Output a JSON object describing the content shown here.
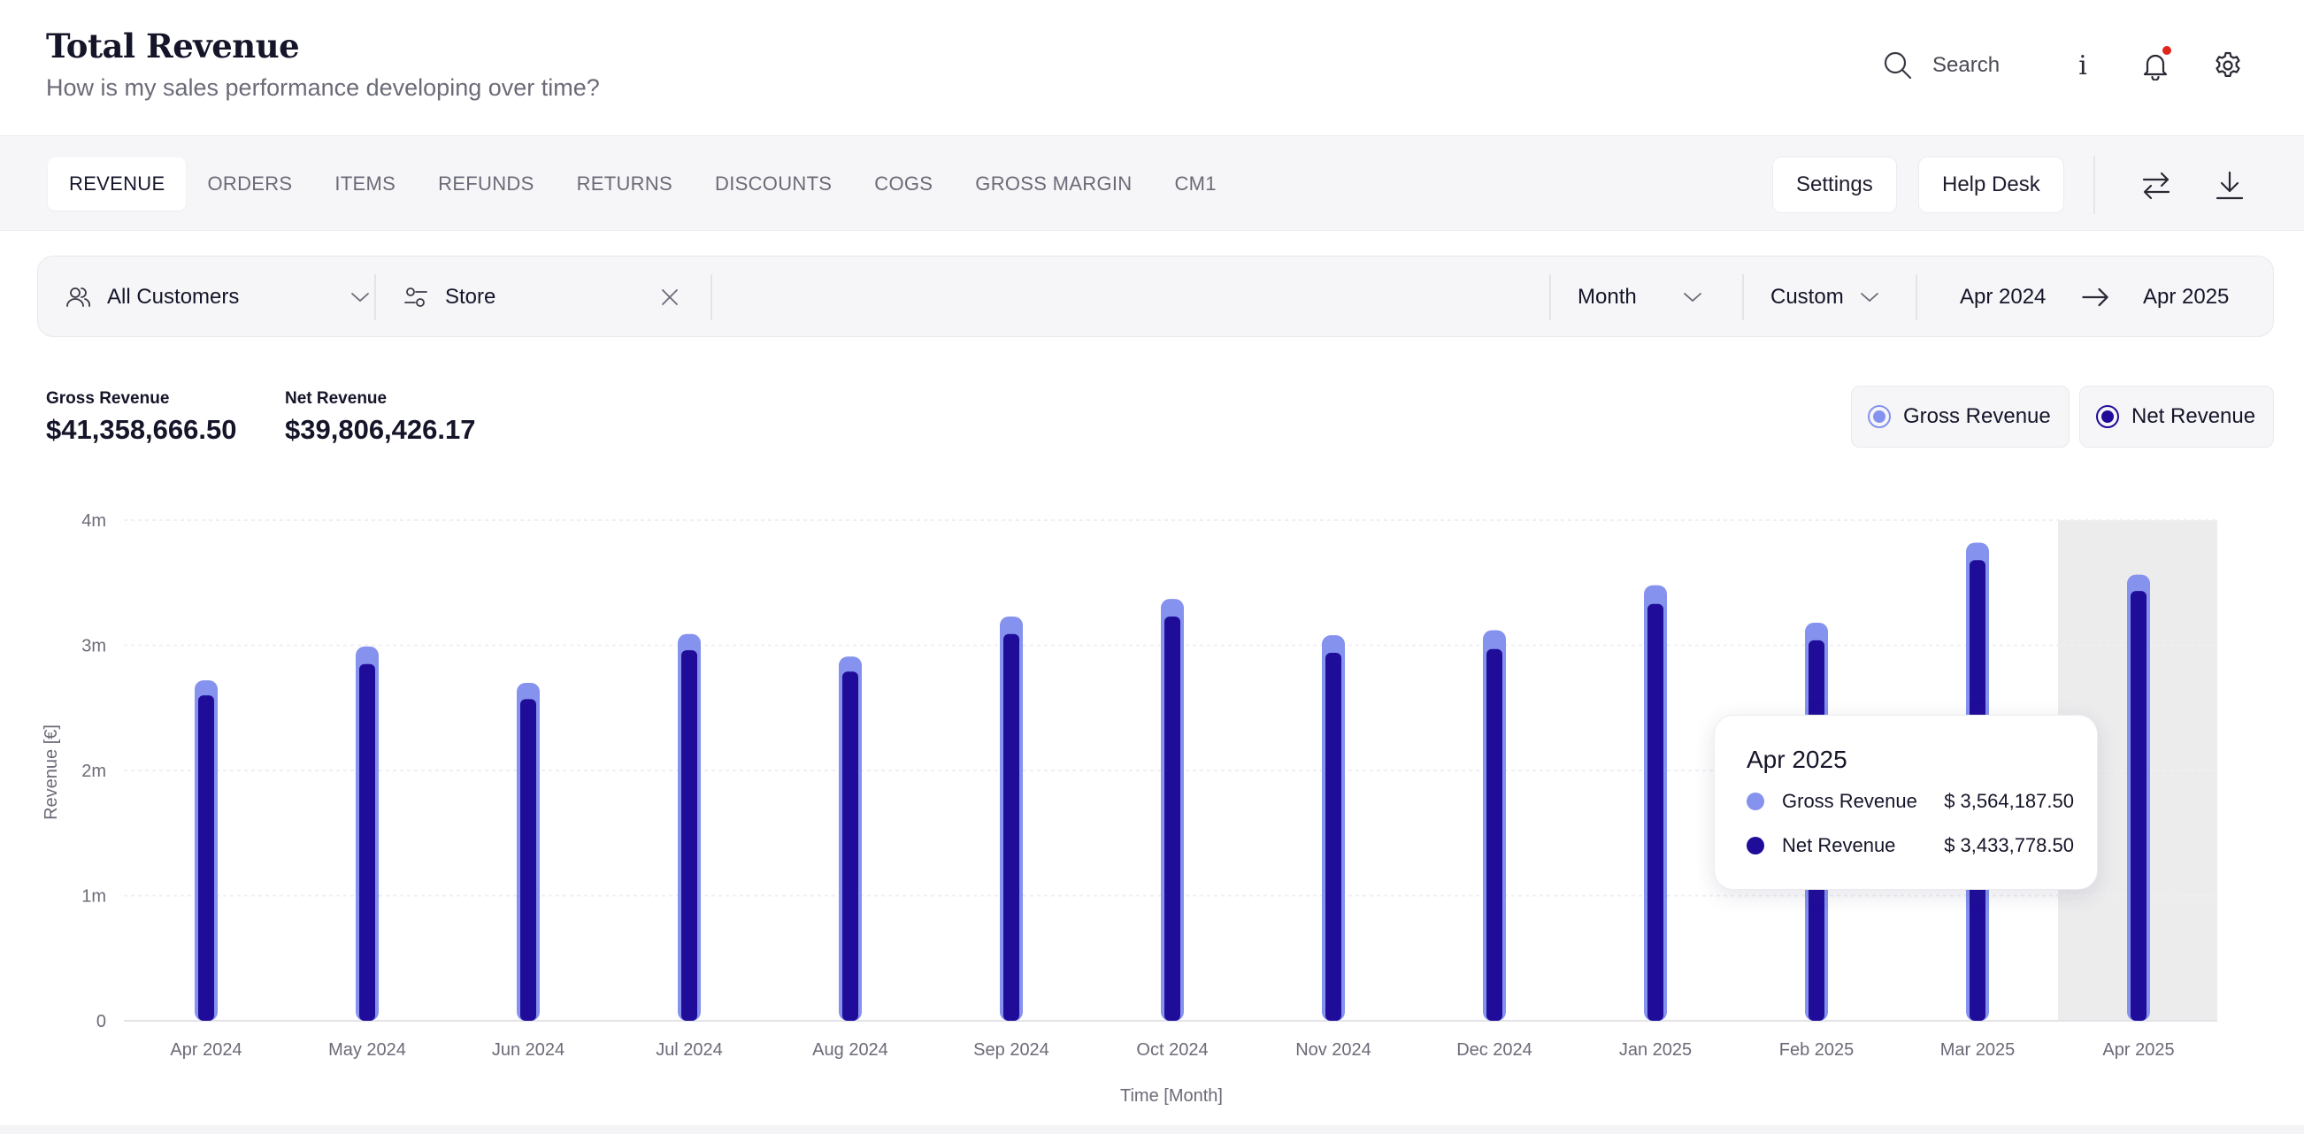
{
  "header": {
    "title": "Total Revenue",
    "subtitle": "How is my sales performance developing over time?",
    "search_label": "Search",
    "info_label": "i"
  },
  "tabs": [
    {
      "label": "REVENUE",
      "active": true
    },
    {
      "label": "ORDERS"
    },
    {
      "label": "ITEMS"
    },
    {
      "label": "REFUNDS"
    },
    {
      "label": "RETURNS"
    },
    {
      "label": "DISCOUNTS"
    },
    {
      "label": "COGS"
    },
    {
      "label": "GROSS MARGIN"
    },
    {
      "label": "CM1"
    }
  ],
  "toolbar": {
    "settings_label": "Settings",
    "helpdesk_label": "Help Desk"
  },
  "filters": {
    "customers": "All Customers",
    "store": "Store",
    "granularity": "Month",
    "range_mode": "Custom",
    "date_from": "Apr 2024",
    "date_to": "Apr 2025"
  },
  "kpis": {
    "gross_label": "Gross Revenue",
    "gross_value": "$41,358,666.50",
    "net_label": "Net Revenue",
    "net_value": "$39,806,426.17"
  },
  "legend": {
    "gross": "Gross Revenue",
    "net": "Net Revenue"
  },
  "colors": {
    "gross": "#8592ee",
    "net": "#1f0d9a",
    "accent": "#15152a",
    "notification": "#e0261d"
  },
  "tooltip": {
    "title": "Apr 2025",
    "gross_label": "Gross Revenue",
    "gross_value": "$ 3,564,187.50",
    "net_label": "Net Revenue",
    "net_value": "$ 3,433,778.50"
  },
  "chart_data": {
    "type": "bar",
    "xlabel": "Time [Month]",
    "ylabel": "Revenue [€]",
    "ylim": [
      0,
      4000000
    ],
    "yticks": [
      {
        "value": 0,
        "label": "0"
      },
      {
        "value": 1000000,
        "label": "1m"
      },
      {
        "value": 2000000,
        "label": "2m"
      },
      {
        "value": 3000000,
        "label": "3m"
      },
      {
        "value": 4000000,
        "label": "4m"
      }
    ],
    "categories": [
      "Apr 2024",
      "May 2024",
      "Jun 2024",
      "Jul 2024",
      "Aug 2024",
      "Sep 2024",
      "Oct 2024",
      "Nov 2024",
      "Dec 2024",
      "Jan 2025",
      "Feb 2025",
      "Mar 2025",
      "Apr 2025"
    ],
    "series": [
      {
        "name": "Gross Revenue",
        "values": [
          2720000,
          2990000,
          2700000,
          3090000,
          2910000,
          3230000,
          3370000,
          3080000,
          3120000,
          3480000,
          3180000,
          3820000,
          3564187.5
        ]
      },
      {
        "name": "Net Revenue",
        "values": [
          2600000,
          2850000,
          2570000,
          2960000,
          2790000,
          3090000,
          3230000,
          2940000,
          2970000,
          3330000,
          3040000,
          3680000,
          3433778.5
        ]
      }
    ],
    "highlighted_category": "Apr 2025",
    "grid": true,
    "legend": "top-right"
  }
}
